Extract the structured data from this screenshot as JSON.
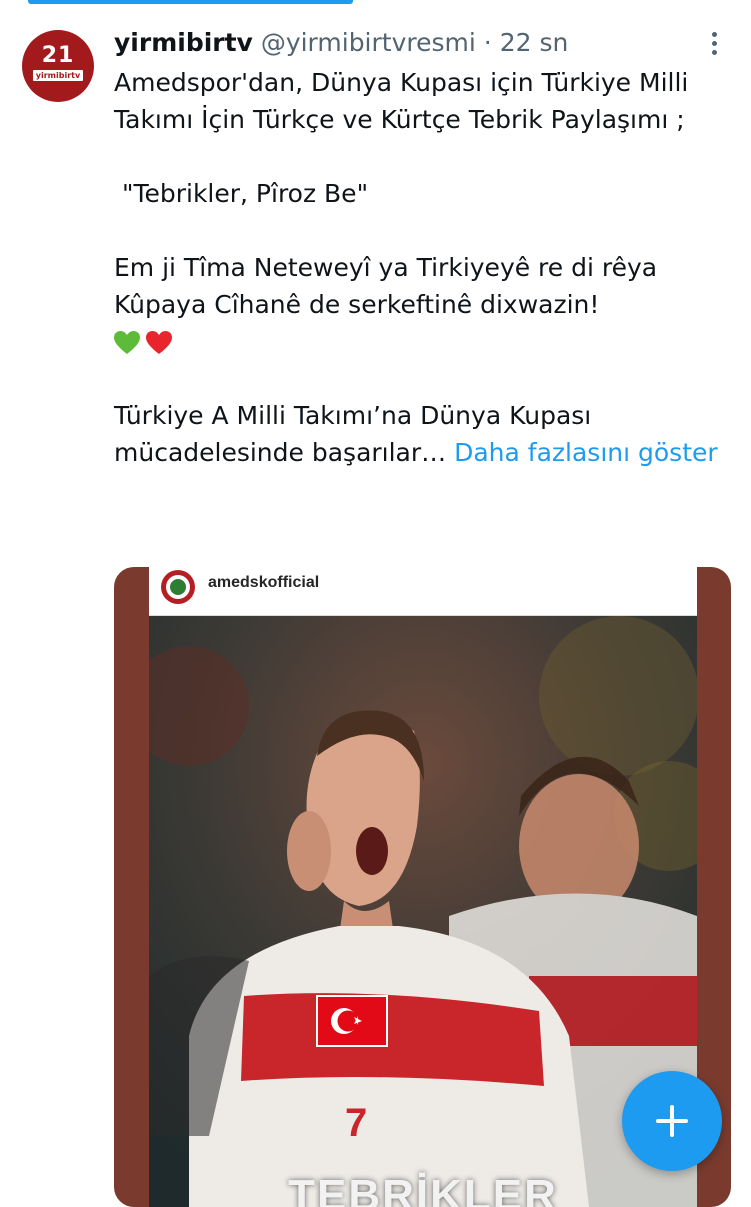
{
  "colors": {
    "accent": "#1d9bf0",
    "text": "#0f1419",
    "muted": "#536471",
    "avatar_red": "#a31a1d"
  },
  "top_progress": {
    "value_fraction": 0.45
  },
  "tweet": {
    "avatar": {
      "icon": "yirmibirtv-logo",
      "number": "21",
      "name": "yirmibirtv"
    },
    "display_name": "yirmibirtv",
    "handle": "@yirmibirtvresmi",
    "separator": "·",
    "time": "22 sn",
    "more_icon": "more-vertical-icon",
    "text": {
      "line1": "Amedspor'dan, Dünya Kupası için Türkiye Milli Takımı İçin  Türkçe ve Kürtçe Tebrik Paylaşımı ;",
      "line2": " \"Tebrikler, Pîroz Be\"",
      "line3": "Em ji Tîma Neteweyî ya Tirkiyeyê re di rêya Kûpaya Cîhanê de serkeftinê dixwazin!",
      "emoji": [
        "green-heart-icon",
        "red-heart-icon"
      ],
      "line4": "Türkiye A Milli Takımı’na Dünya Kupası mücadelesinde başarılar…",
      "show_more": "Daha fazlasını göster"
    },
    "media": {
      "ig_username": "amedskofficial",
      "ig_avatar_icon": "amedspor-logo",
      "overlay_text": "TEBRİKLER",
      "jersey_number": "7"
    }
  },
  "fab": {
    "icon": "plus-icon"
  }
}
